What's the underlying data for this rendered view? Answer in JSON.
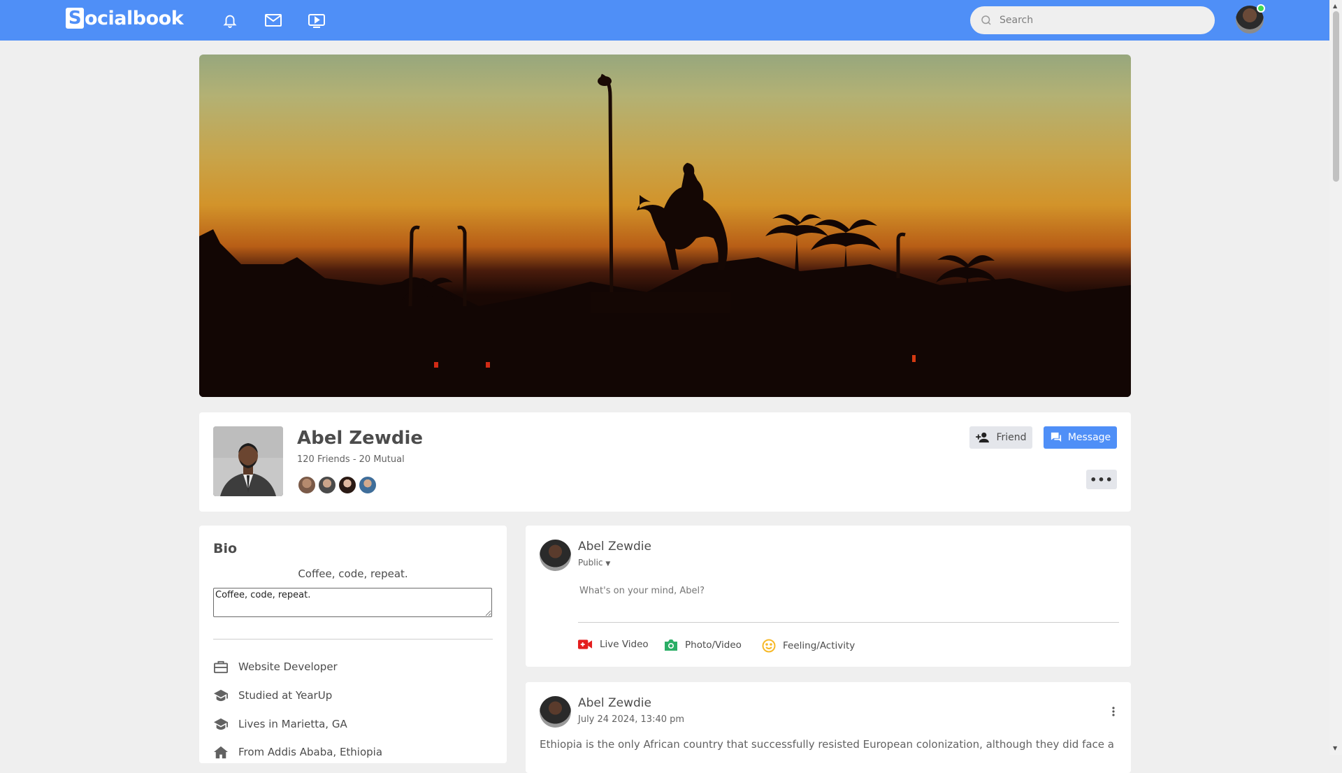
{
  "brand": {
    "letter": "S",
    "rest": "ocialbook",
    "color": "#4f8ff7"
  },
  "nav": {
    "icons": [
      "bell-icon",
      "mail-icon",
      "video-icon"
    ],
    "search_placeholder": "Search"
  },
  "profile": {
    "name": "Abel Zewdie",
    "friends_text": "120 Friends - 20 Mutual",
    "friend_button": "Friend",
    "message_button": "Message",
    "more_button": "•••"
  },
  "bio": {
    "title": "Bio",
    "text": "Coffee, code, repeat.",
    "textarea_value": "Coffee, code, repeat.",
    "items": [
      {
        "icon": "briefcase-icon",
        "label": "Website Developer"
      },
      {
        "icon": "graduation-cap-icon",
        "label": "Studied at YearUp"
      },
      {
        "icon": "graduation-cap-icon",
        "label": "Lives in Marietta, GA"
      },
      {
        "icon": "home-icon",
        "label": "From Addis Ababa, Ethiopia"
      }
    ]
  },
  "composer": {
    "user_name": "Abel Zewdie",
    "privacy": "Public",
    "placeholder": "What's on your mind, Abel?",
    "actions": [
      {
        "icon": "live-video-icon",
        "label": "Live Video",
        "color": "#e41e1e"
      },
      {
        "icon": "camera-icon",
        "label": "Photo/Video",
        "color": "#2bae66"
      },
      {
        "icon": "smiley-icon",
        "label": "Feeling/Activity",
        "color": "#f7b928"
      }
    ]
  },
  "post": {
    "user_name": "Abel Zewdie",
    "timestamp": "July 24 2024, 13:40 pm",
    "text": "Ethiopia is the only African country that successfully resisted European colonization, although they did face a"
  }
}
